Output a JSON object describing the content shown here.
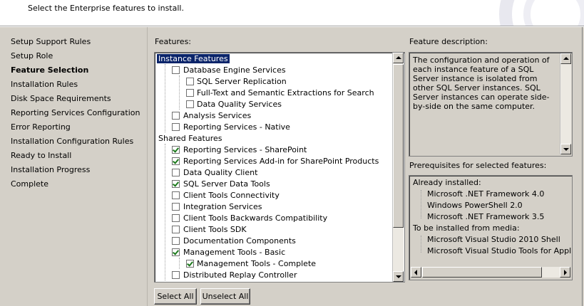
{
  "header": {
    "subtitle": "Select the Enterprise features to install."
  },
  "nav": {
    "items": [
      {
        "label": "Setup Support Rules",
        "active": false
      },
      {
        "label": "Setup Role",
        "active": false
      },
      {
        "label": "Feature Selection",
        "active": true
      },
      {
        "label": "Installation Rules",
        "active": false
      },
      {
        "label": "Disk Space Requirements",
        "active": false
      },
      {
        "label": "Reporting Services Configuration",
        "active": false
      },
      {
        "label": "Error Reporting",
        "active": false
      },
      {
        "label": "Installation Configuration Rules",
        "active": false
      },
      {
        "label": "Ready to Install",
        "active": false
      },
      {
        "label": "Installation Progress",
        "active": false
      },
      {
        "label": "Complete",
        "active": false
      }
    ]
  },
  "features": {
    "label": "Features:",
    "tree": [
      {
        "label": "Instance Features",
        "level": 0,
        "checkbox": false,
        "checked": false,
        "selected": true
      },
      {
        "label": "Database Engine Services",
        "level": 1,
        "checkbox": true,
        "checked": false
      },
      {
        "label": "SQL Server Replication",
        "level": 2,
        "checkbox": true,
        "checked": false
      },
      {
        "label": "Full-Text and Semantic Extractions for Search",
        "level": 2,
        "checkbox": true,
        "checked": false
      },
      {
        "label": "Data Quality Services",
        "level": 2,
        "checkbox": true,
        "checked": false
      },
      {
        "label": "Analysis Services",
        "level": 1,
        "checkbox": true,
        "checked": false
      },
      {
        "label": "Reporting Services - Native",
        "level": 1,
        "checkbox": true,
        "checked": false
      },
      {
        "label": "Shared Features",
        "level": 0,
        "checkbox": false,
        "checked": false
      },
      {
        "label": "Reporting Services - SharePoint",
        "level": 1,
        "checkbox": true,
        "checked": true
      },
      {
        "label": "Reporting Services Add-in for SharePoint Products",
        "level": 1,
        "checkbox": true,
        "checked": true
      },
      {
        "label": "Data Quality Client",
        "level": 1,
        "checkbox": true,
        "checked": false
      },
      {
        "label": "SQL Server Data Tools",
        "level": 1,
        "checkbox": true,
        "checked": true
      },
      {
        "label": "Client Tools Connectivity",
        "level": 1,
        "checkbox": true,
        "checked": false
      },
      {
        "label": "Integration Services",
        "level": 1,
        "checkbox": true,
        "checked": false
      },
      {
        "label": "Client Tools Backwards Compatibility",
        "level": 1,
        "checkbox": true,
        "checked": false
      },
      {
        "label": "Client Tools SDK",
        "level": 1,
        "checkbox": true,
        "checked": false
      },
      {
        "label": "Documentation Components",
        "level": 1,
        "checkbox": true,
        "checked": false
      },
      {
        "label": "Management Tools - Basic",
        "level": 1,
        "checkbox": true,
        "checked": true
      },
      {
        "label": "Management Tools - Complete",
        "level": 2,
        "checkbox": true,
        "checked": true
      },
      {
        "label": "Distributed Replay Controller",
        "level": 1,
        "checkbox": true,
        "checked": false
      }
    ]
  },
  "description": {
    "label": "Feature description:",
    "text": "The configuration and operation of each instance feature of a SQL Server instance is isolated from other SQL Server instances. SQL Server instances can operate side-by-side on the same computer."
  },
  "prerequisites": {
    "label": "Prerequisites for selected features:",
    "rows": [
      {
        "text": "Already installed:",
        "indent": 0
      },
      {
        "text": "Microsoft .NET Framework 4.0",
        "indent": 1
      },
      {
        "text": "Windows PowerShell 2.0",
        "indent": 1
      },
      {
        "text": "Microsoft .NET Framework 3.5",
        "indent": 1
      },
      {
        "text": "To be installed from media:",
        "indent": 0
      },
      {
        "text": "Microsoft Visual Studio 2010 Shell",
        "indent": 1
      },
      {
        "text": "Microsoft Visual Studio Tools for Applications",
        "indent": 1
      }
    ]
  },
  "buttons": {
    "select_all": "Select All",
    "unselect_all": "Unselect All"
  }
}
